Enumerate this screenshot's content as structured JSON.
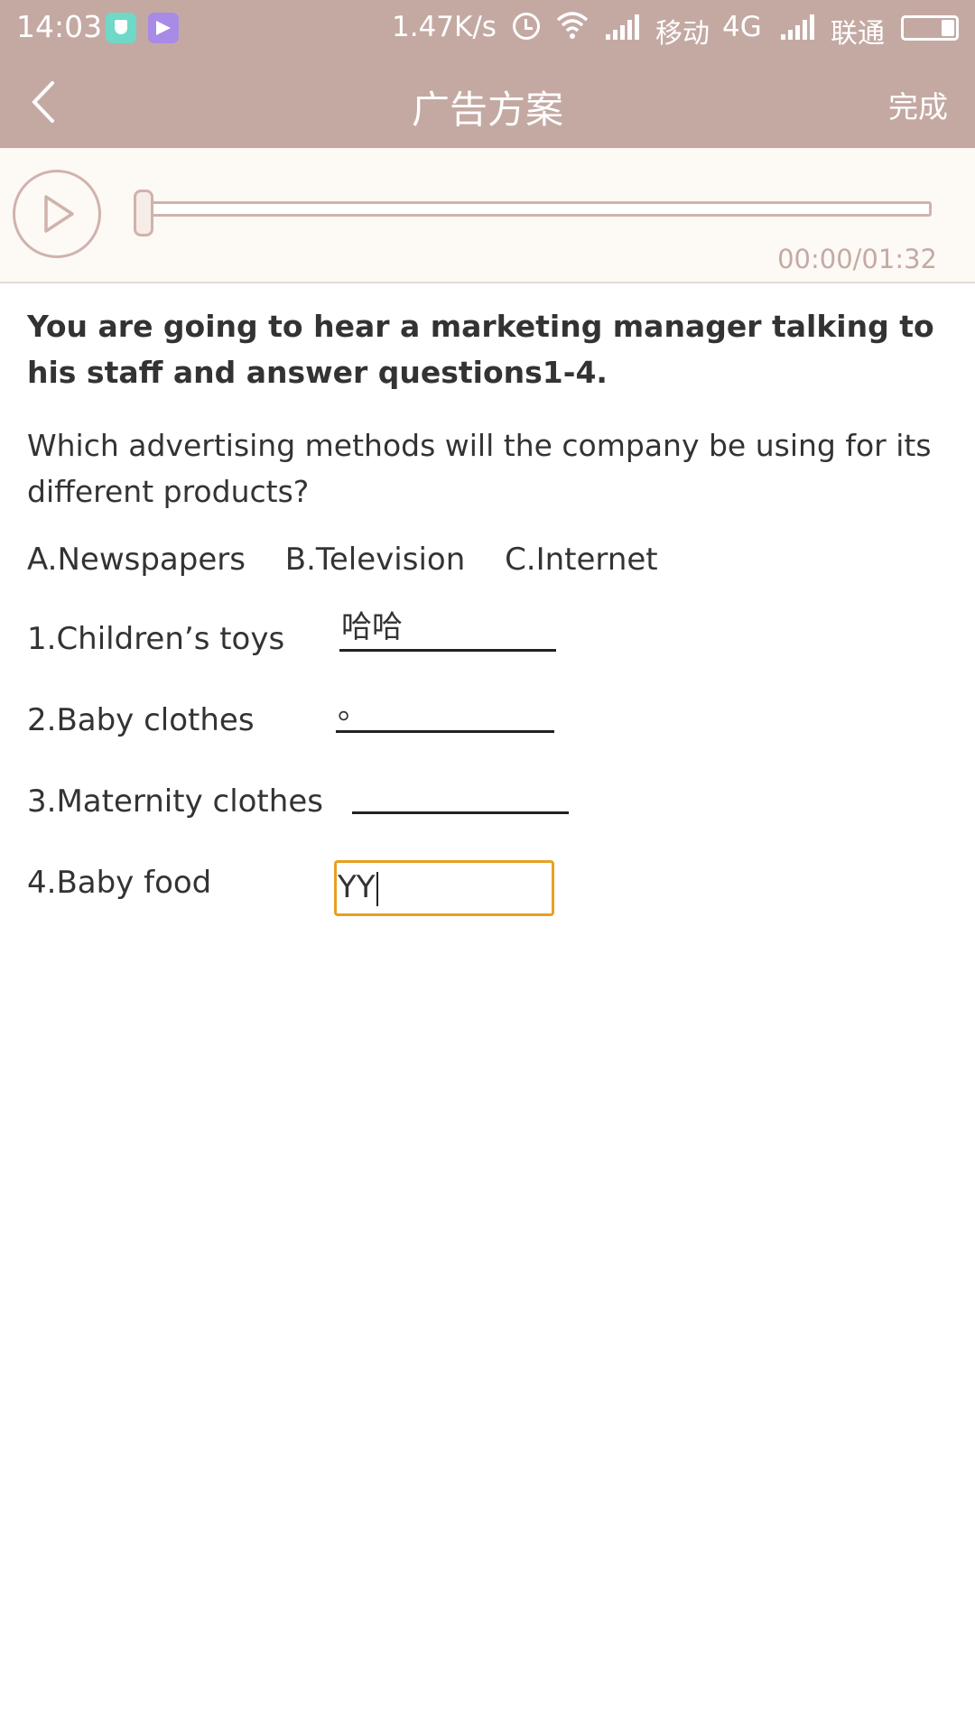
{
  "status_bar": {
    "time": "14:03",
    "net_speed": "1.47K/s",
    "carrier_1": "移动",
    "network_type": "4G",
    "carrier_2": "联通",
    "icons": [
      "shield-badge-icon",
      "plane-badge-icon",
      "alarm-icon",
      "wifi-icon",
      "signal-icon",
      "signal-icon",
      "battery-icon"
    ]
  },
  "header": {
    "title": "广告方案",
    "done_label": "完成",
    "back_icon": "chevron-left-icon"
  },
  "player": {
    "time": "00:00/01:32",
    "progress": 0,
    "play_icon": "play-icon"
  },
  "exercise": {
    "instruction": "You are going to hear a marketing manager talking to his staff and answer questions1-4.",
    "question": "Which advertising methods will the company be using for its different products?",
    "options": [
      "A.Newspapers",
      "B.Television",
      "C.Internet"
    ],
    "items": [
      {
        "label": "1.Children’s toys",
        "answer": "哈哈"
      },
      {
        "label": "2.Baby clothes",
        "answer": "。"
      },
      {
        "label": "3.Maternity clothes",
        "answer": ""
      },
      {
        "label": "4.Baby food",
        "answer": "YY"
      }
    ]
  },
  "colors": {
    "header_bg": "#c4a9a3",
    "player_bg": "#fdf9f5",
    "accent": "#cfb3ac",
    "active_input_border": "#e8a021"
  }
}
